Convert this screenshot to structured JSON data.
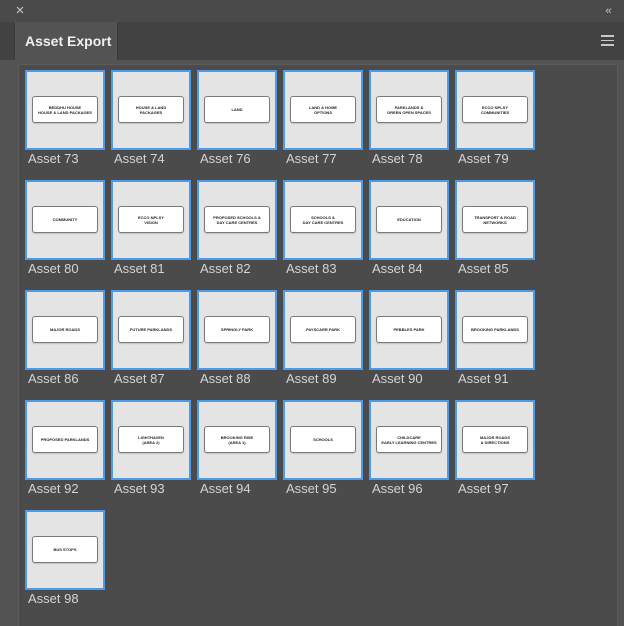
{
  "window": {
    "close_icon": "×",
    "collapse_icon": "‹‹",
    "title_tab": "Asset Export",
    "menu_icon": "hamburger-menu-icon"
  },
  "colors": {
    "panel_bg": "#535353",
    "selection_border": "#4c9bea",
    "thumb_bg": "#e4e4e4"
  },
  "assets": [
    {
      "name": "Asset 73",
      "card_text": "BEDDHU HOUSE\nHOUSE & LAND PACKAGES"
    },
    {
      "name": "Asset 74",
      "card_text": "HOUSE & LAND\nPACKAGES"
    },
    {
      "name": "Asset 76",
      "card_text": "LAND"
    },
    {
      "name": "Asset 77",
      "card_text": "LAND & HOME\nOPTIONS"
    },
    {
      "name": "Asset 78",
      "card_text": "PARKLANDS &\nGREEN OPEN SPACES"
    },
    {
      "name": "Asset 79",
      "card_text": "ECCO NPLSY\nCOMMUNITIES"
    },
    {
      "name": "Asset 80",
      "card_text": "COMMUNITY"
    },
    {
      "name": "Asset 81",
      "card_text": "ECCO NPLSY\nVISION"
    },
    {
      "name": "Asset 82",
      "card_text": "PROPOSED SCHOOLS &\nDAY CARE CENTRES"
    },
    {
      "name": "Asset 83",
      "card_text": "SCHOOLS &\nDAY CARE CENTRES"
    },
    {
      "name": "Asset 84",
      "card_text": "EDUCATION"
    },
    {
      "name": "Asset 85",
      "card_text": "TRANSPORT & ROAD\nNETWORKS"
    },
    {
      "name": "Asset 86",
      "card_text": "MAJOR ROADS"
    },
    {
      "name": "Asset 87",
      "card_text": "FUTURE PARKLANDS"
    },
    {
      "name": "Asset 88",
      "card_text": "SPRINGLY PARK"
    },
    {
      "name": "Asset 89",
      "card_text": "PAYSCARR PARK"
    },
    {
      "name": "Asset 90",
      "card_text": "PEBBLES PARK"
    },
    {
      "name": "Asset 91",
      "card_text": "BROOKING PARKLANDS"
    },
    {
      "name": "Asset 92",
      "card_text": "PROPOSED PARKLANDS"
    },
    {
      "name": "Asset 93",
      "card_text": "LIGHTHAVEN\n(AREA 2)"
    },
    {
      "name": "Asset 94",
      "card_text": "BROOKING RISE\n(AREA 1)"
    },
    {
      "name": "Asset 95",
      "card_text": "SCHOOLS"
    },
    {
      "name": "Asset 96",
      "card_text": "CHILDCARE\nEARLY LEARNING CENTRES"
    },
    {
      "name": "Asset 97",
      "card_text": "MAJOR ROADS\n& DIRECTIONS"
    },
    {
      "name": "Asset 98",
      "card_text": "BUS STOPS"
    }
  ]
}
